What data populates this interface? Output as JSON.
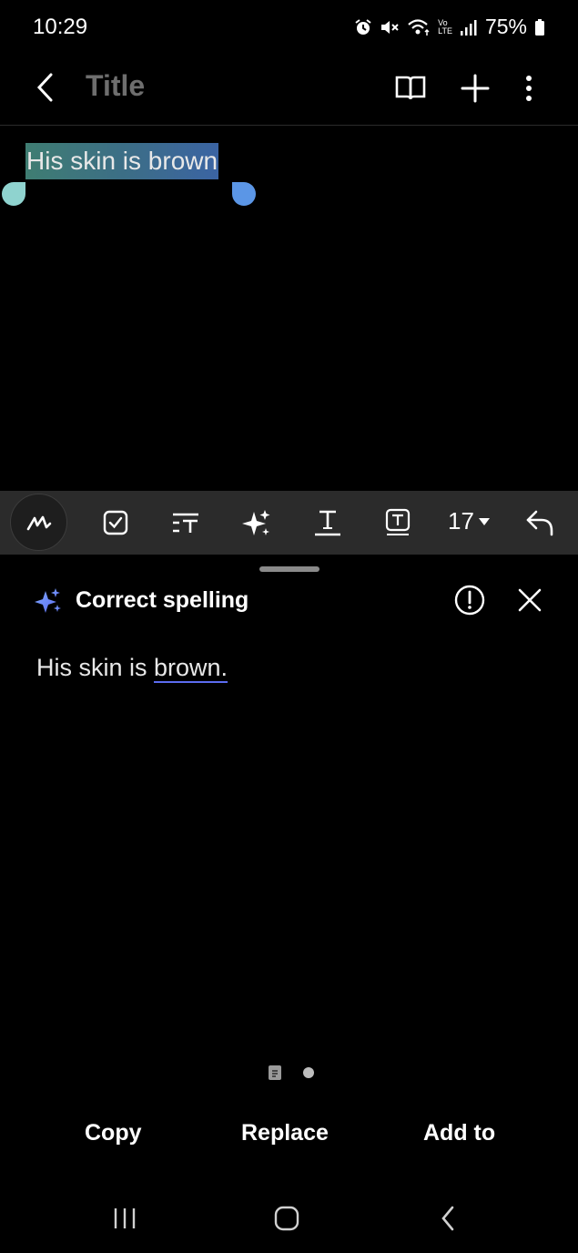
{
  "status_bar": {
    "time": "10:29",
    "network_label_top": "Vo",
    "network_label_bottom": "LTE",
    "battery_percent": "75%",
    "icons": [
      "alarm-icon",
      "mute-icon",
      "wifi-icon",
      "volte-icon",
      "signal-icon",
      "battery-icon"
    ]
  },
  "app_bar": {
    "title": "Title",
    "icons": [
      "back-icon",
      "reading-mode-icon",
      "add-icon",
      "more-icon"
    ]
  },
  "editor": {
    "selected_text": "His skin is brown",
    "handle_left_color": "#8fd3cf",
    "handle_right_color": "#5b96e6"
  },
  "toolbar": {
    "icons": [
      "pen-icon",
      "checkbox-icon",
      "text-style-icon",
      "ai-sparkle-icon",
      "text-format-icon",
      "text-box-icon",
      "undo-icon"
    ],
    "font_size": "17"
  },
  "sheet": {
    "title": "Correct spelling",
    "result_prefix": "His skin is ",
    "result_corrected": "brown.",
    "accent": "#5c6cf0",
    "actions": {
      "copy": "Copy",
      "replace": "Replace",
      "add_to": "Add to"
    }
  },
  "nav_bar": {
    "icons": [
      "recents-icon",
      "home-icon",
      "back-icon"
    ]
  }
}
